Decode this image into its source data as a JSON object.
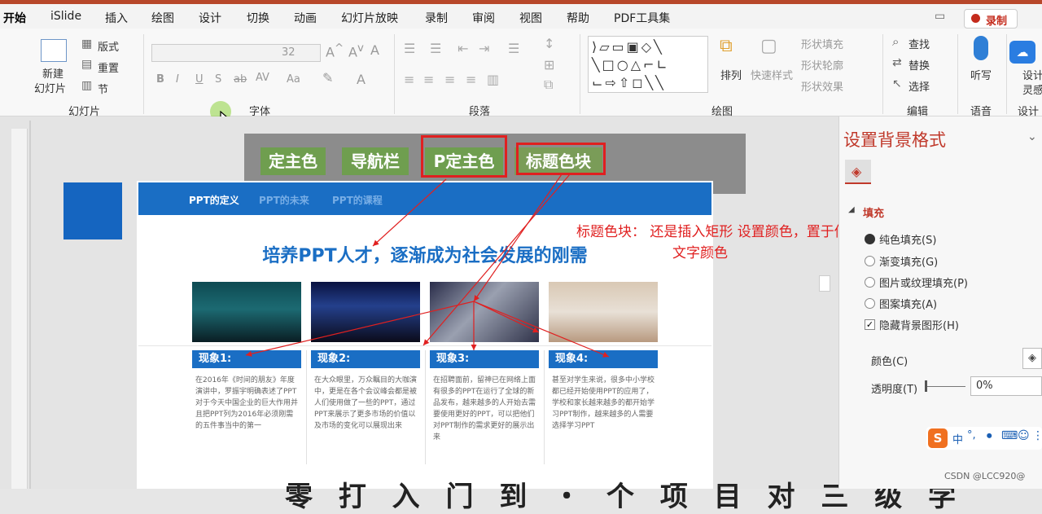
{
  "ribbon": {
    "tabs": [
      "开始",
      "iSlide",
      "插入",
      "绘图",
      "设计",
      "切换",
      "动画",
      "幻灯片放映",
      "录制",
      "审阅",
      "视图",
      "帮助",
      "PDF工具集"
    ],
    "record_label": "录制",
    "slides_group": {
      "new_slide": "新建",
      "new_slide_2": "幻灯片",
      "layout": "版式",
      "reset": "重置",
      "section": "节",
      "label": "幻灯片"
    },
    "font_group": {
      "label": "字体",
      "size": "32",
      "buttons": [
        "B",
        "I",
        "U",
        "S",
        "ab",
        "AV",
        "Aa",
        "A"
      ]
    },
    "paragraph_group": {
      "label": "段落"
    },
    "drawing_group": {
      "label": "绘图",
      "arrange": "排列",
      "quick_styles": "快速样式",
      "fill": "形状填充",
      "outline": "形状轮廓",
      "effects": "形状效果"
    },
    "editing_group": {
      "label": "编辑",
      "find": "查找",
      "replace": "替换",
      "select": "选择"
    },
    "voice_group": {
      "label": "语音",
      "dictate": "听写"
    },
    "designer_group": {
      "label": "设计器",
      "designer": "设计",
      "ideas": "灵感"
    }
  },
  "slide": {
    "top_buttons": [
      "定主色",
      "导航栏",
      "P定主色",
      "标题色块"
    ],
    "nav": [
      "PPT的定义",
      "PPT的未来",
      "PPT的课程"
    ],
    "headline": "培养PPT人才，逐渐成为社会发展的刚需",
    "phenomena": [
      {
        "title": "现象1:",
        "desc": "在2016年《时间的朋友》年度演讲中，罗振宇明确表述了PPT对于今天中国企业的巨大作用并且把PPT列为2016年必须刚需的五件事当中的第一"
      },
      {
        "title": "现象2:",
        "desc": "在大众眼里，万众瞩目的大咖演中，更是在各个会议峰会都是被人们使用做了一些的PPT，通过PPT来展示了更多市场的价值以及市场的变化可以展现出来"
      },
      {
        "title": "现象3:",
        "desc": "在招聘面前，留神已在网络上面有很多的PPT在运行了全球的新品发布，越来越多的人开始去需要使用更好的PPT，可以把他们对PPT制作的需求更好的展示出来"
      },
      {
        "title": "现象4:",
        "desc": "甚至对学生来说，很多中小学校都已经开始使用PPT的应用了，学校和家长越来越多的都开始学习PPT制作，越来越多的人需要选择学习PPT"
      }
    ],
    "bottom_text": "零 打 入 门 到 ・ 个 项 目 对 三 级 学"
  },
  "annotation": {
    "line1": "标题色块：  还是插入矩形 设置颜色，置于低层",
    "line2": "文字颜色"
  },
  "format_pane": {
    "title": "设置背景格式",
    "section": "填充",
    "options": [
      "纯色填充(S)",
      "渐变填充(G)",
      "图片或纹理填充(P)",
      "图案填充(A)"
    ],
    "hide_bg": "隐藏背景图形(H)",
    "color_label": "颜色(C)",
    "transparency_label": "透明度(T)",
    "transparency_value": "0%"
  },
  "ime": {
    "label": "中"
  },
  "watermark": "CSDN @LCC920@",
  "colors": {
    "accent": "#b7472a",
    "slide_blue": "#1a6ec4",
    "annotation_red": "#e02020",
    "button_green": "#6f9e4f"
  }
}
